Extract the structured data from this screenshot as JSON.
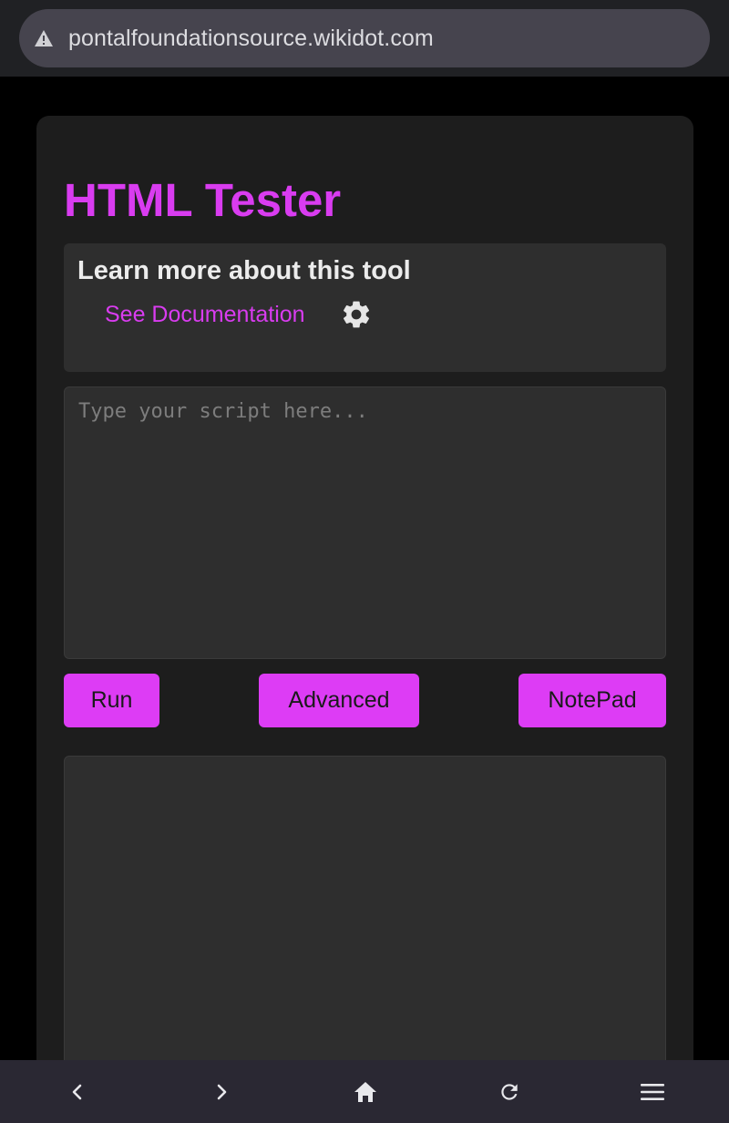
{
  "browser": {
    "url": "pontalfoundationsource.wikidot.com",
    "security_icon": "warning-triangle-icon"
  },
  "page": {
    "title": "HTML Tester",
    "info_heading": "Learn more about this tool",
    "doc_link": "See Documentation",
    "settings_icon": "gear-icon",
    "script_placeholder": "Type your script here...",
    "script_value": "",
    "buttons": {
      "run": "Run",
      "advanced": "Advanced",
      "notepad": "NotePad"
    }
  },
  "bottom_nav": [
    "back-icon",
    "forward-icon",
    "home-icon",
    "reload-icon",
    "menu-icon"
  ],
  "colors": {
    "accent": "#d93cf0",
    "button_bg": "#dd3cf5",
    "card_bg": "#1d1d1d",
    "panel_bg": "#2e2e2e"
  }
}
